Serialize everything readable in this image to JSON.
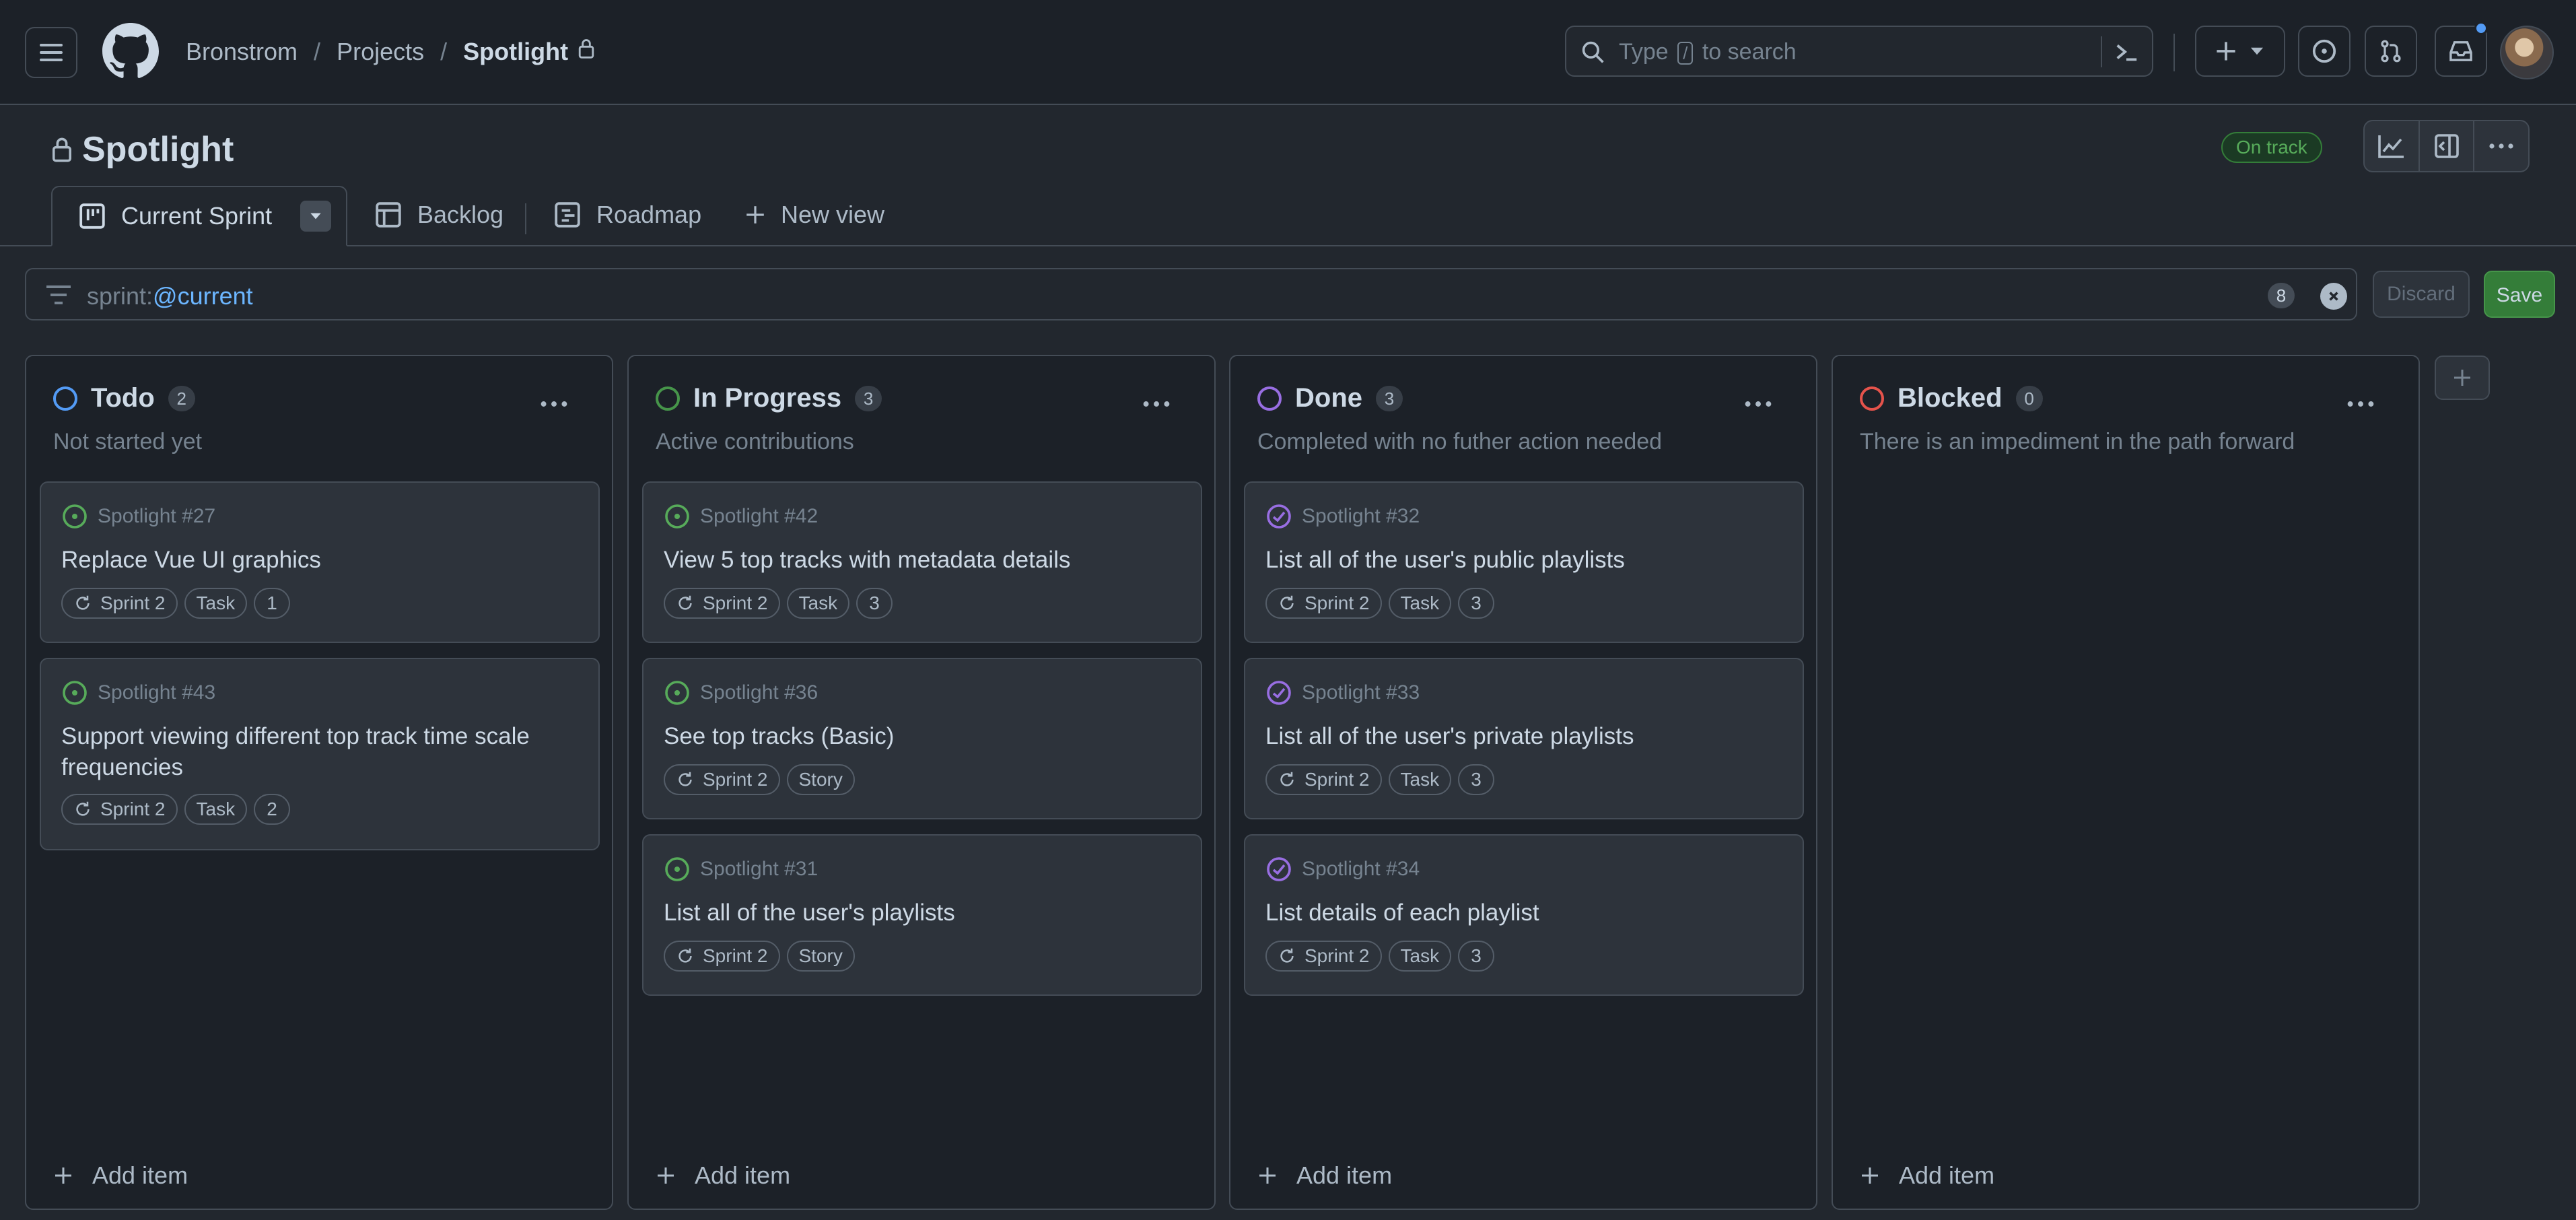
{
  "breadcrumbs": {
    "owner": "Bronstrom",
    "section": "Projects",
    "project": "Spotlight",
    "sep": "/"
  },
  "search": {
    "before": "Type",
    "key": "/",
    "after": "to search"
  },
  "project": {
    "title": "Spotlight",
    "status": "On track"
  },
  "tabs": [
    {
      "label": "Current Sprint"
    },
    {
      "label": "Backlog"
    },
    {
      "label": "Roadmap"
    },
    {
      "label": "New view"
    }
  ],
  "filter": {
    "prefix": "sprint:",
    "value": "@current",
    "count": "8",
    "discard": "Discard",
    "save": "Save"
  },
  "columns": [
    {
      "name": "Todo",
      "count": "2",
      "desc": "Not started yet",
      "color": "#539bf5",
      "add": "Add item",
      "cards": [
        {
          "ref": "Spotlight #27",
          "title": "Replace Vue UI graphics",
          "sprint": "Sprint 2",
          "type": "Task",
          "points": "1",
          "state": "open"
        },
        {
          "ref": "Spotlight #43",
          "title": "Support viewing different top track time scale frequencies",
          "sprint": "Sprint 2",
          "type": "Task",
          "points": "2",
          "state": "open"
        }
      ]
    },
    {
      "name": "In Progress",
      "count": "3",
      "desc": "Active contributions",
      "color": "#46954a",
      "add": "Add item",
      "cards": [
        {
          "ref": "Spotlight #42",
          "title": "View 5 top tracks with metadata details",
          "sprint": "Sprint 2",
          "type": "Task",
          "points": "3",
          "state": "open"
        },
        {
          "ref": "Spotlight #36",
          "title": "See top tracks (Basic)",
          "sprint": "Sprint 2",
          "type": "Story",
          "points": "",
          "state": "open"
        },
        {
          "ref": "Spotlight #31",
          "title": "List all of the user's playlists",
          "sprint": "Sprint 2",
          "type": "Story",
          "points": "",
          "state": "open"
        }
      ]
    },
    {
      "name": "Done",
      "count": "3",
      "desc": "Completed with no futher action needed",
      "color": "#986ee2",
      "add": "Add item",
      "cards": [
        {
          "ref": "Spotlight #32",
          "title": "List all of the user's public playlists",
          "sprint": "Sprint 2",
          "type": "Task",
          "points": "3",
          "state": "closed"
        },
        {
          "ref": "Spotlight #33",
          "title": "List all of the user's private playlists",
          "sprint": "Sprint 2",
          "type": "Task",
          "points": "3",
          "state": "closed"
        },
        {
          "ref": "Spotlight #34",
          "title": "List details of each playlist",
          "sprint": "Sprint 2",
          "type": "Task",
          "points": "3",
          "state": "closed"
        }
      ]
    },
    {
      "name": "Blocked",
      "count": "0",
      "desc": "There is an impediment in the path forward",
      "color": "#e5534b",
      "add": "Add item",
      "cards": []
    }
  ],
  "colors": {
    "open": "#57ab5a",
    "closed": "#986ee2"
  }
}
